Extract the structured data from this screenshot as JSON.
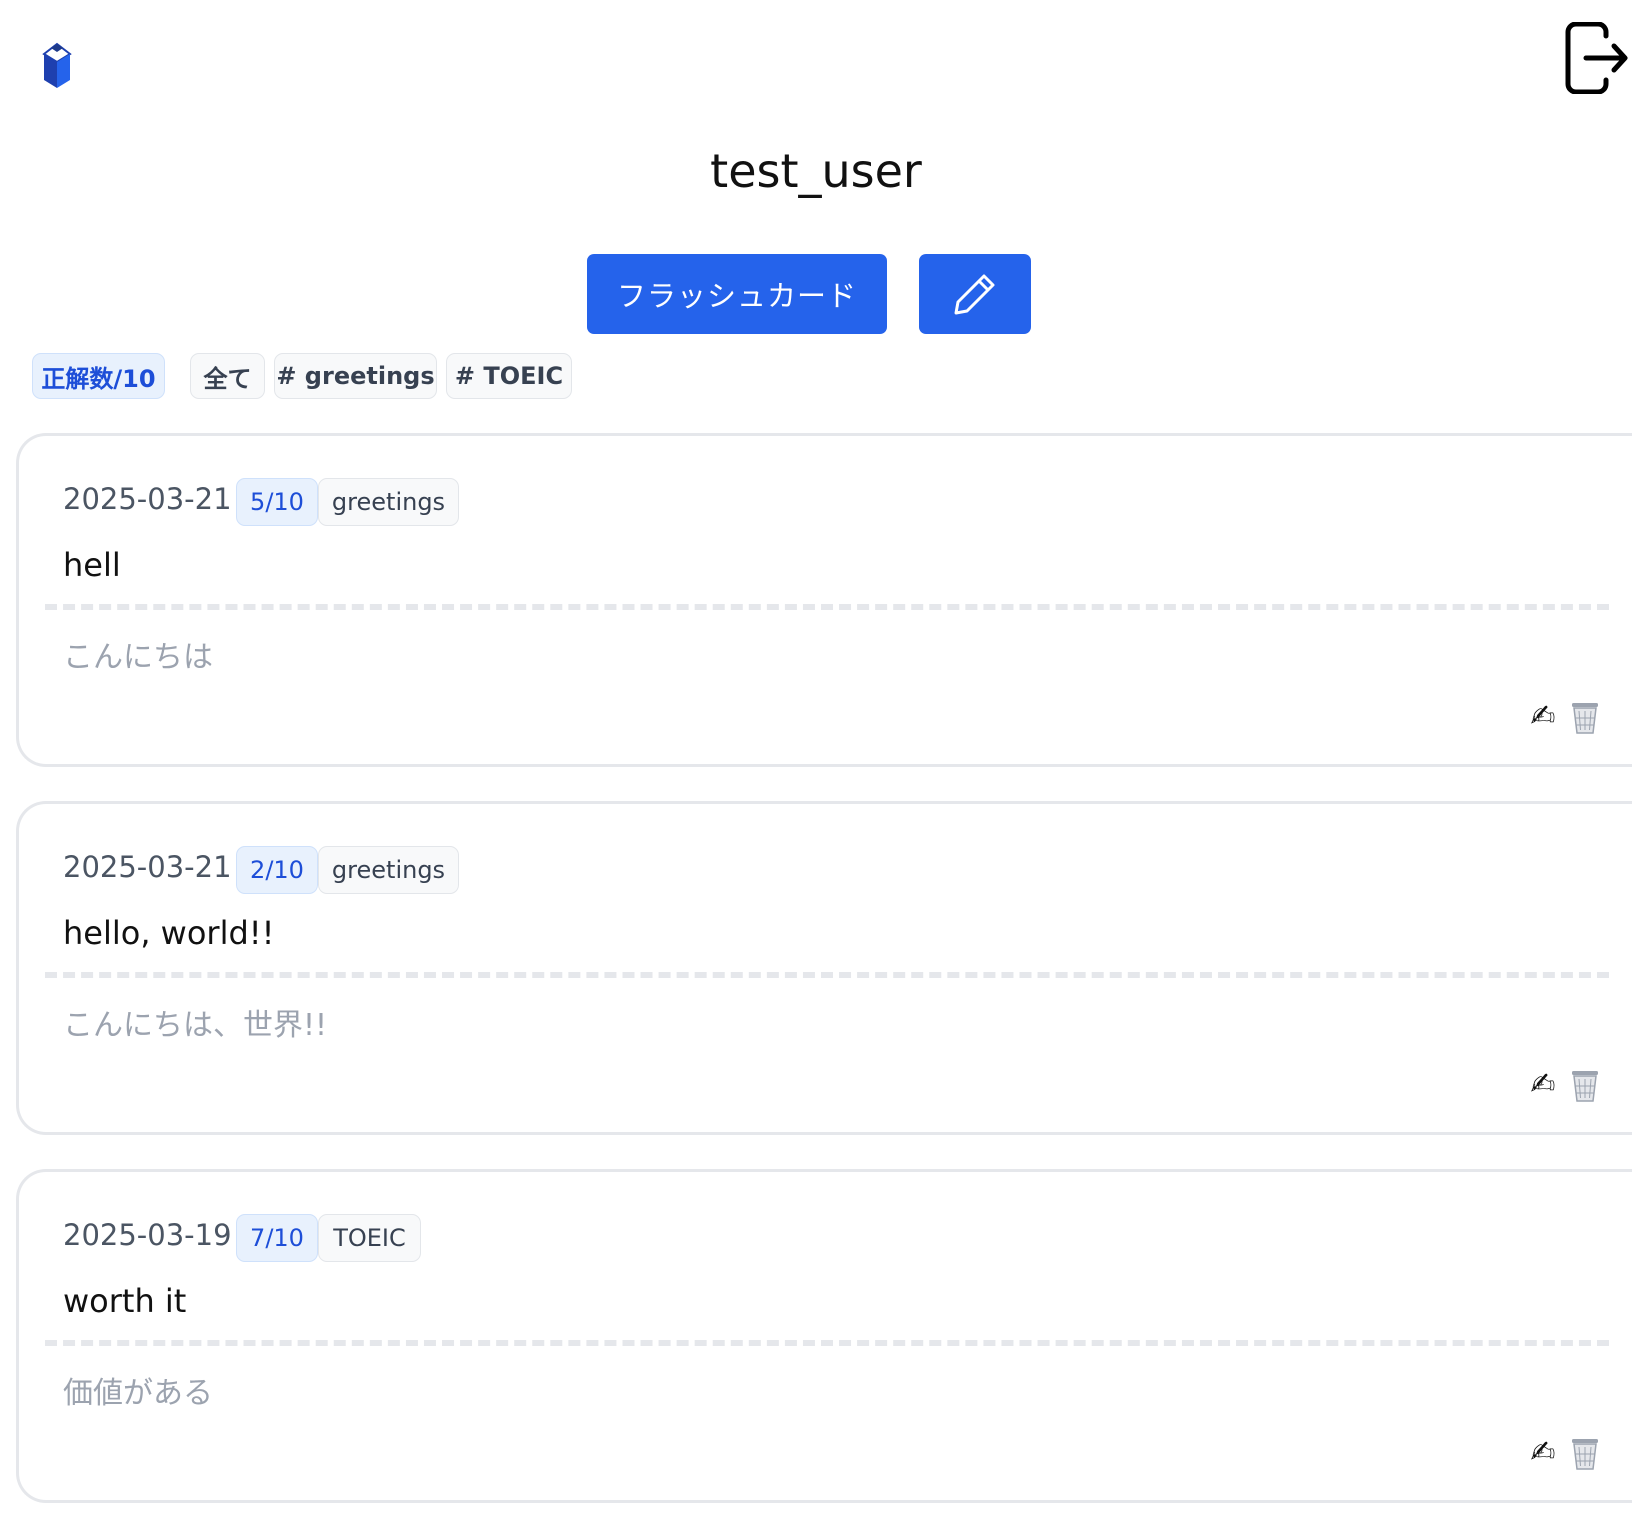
{
  "header": {
    "logo_icon": "book-gem-logo-icon",
    "logout_icon": "logout-icon"
  },
  "user": {
    "name": "test_user"
  },
  "actions": {
    "flashcard_label": "フラッシュカード",
    "edit_icon": "pencil-icon"
  },
  "filters": {
    "sort_label": "正解数/10",
    "all_label": "全て",
    "tags": [
      "# greetings",
      "# TOEIC"
    ]
  },
  "cards": [
    {
      "date": "2025-03-21",
      "score": "5/10",
      "tag": "greetings",
      "word": "hell",
      "meaning": "こんにちは",
      "edit_icon": "✍",
      "delete_icon": "trash-icon"
    },
    {
      "date": "2025-03-21",
      "score": "2/10",
      "tag": "greetings",
      "word": "hello, world!!",
      "meaning": "こんにちは、世界!!",
      "edit_icon": "✍",
      "delete_icon": "trash-icon"
    },
    {
      "date": "2025-03-19",
      "score": "7/10",
      "tag": "TOEIC",
      "word": "worth it",
      "meaning": "価値がある",
      "edit_icon": "✍",
      "delete_icon": "trash-icon"
    }
  ],
  "colors": {
    "primary": "#2563eb",
    "chip_blue_bg": "#e8f1fd",
    "chip_blue_text": "#1d4ed8",
    "muted_text": "#9ca3af",
    "border": "#e5e7eb"
  }
}
